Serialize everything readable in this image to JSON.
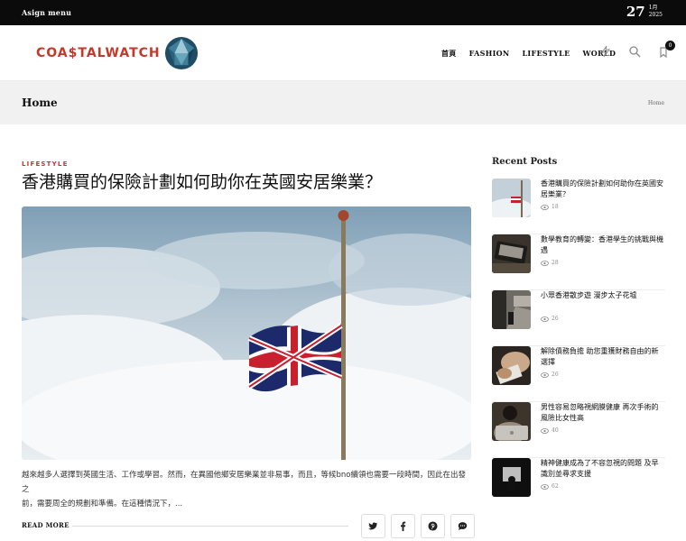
{
  "topbar": {
    "menu_label": "Asign menu",
    "date_day": "27",
    "date_month": "1月",
    "date_year": "2025"
  },
  "header": {
    "logo_text": "COA$TALWATCH",
    "nav": [
      "首頁",
      "FASHION",
      "LIFESTYLE",
      "WORLD"
    ],
    "cart_count": "0"
  },
  "page": {
    "title": "Home",
    "breadcrumb": "Home"
  },
  "article": {
    "category": "LIFESTYLE",
    "title": "香港購買的保險計劃如何助你在英國安居樂業？",
    "excerpt_1": "越來越多人選擇到英國生活、工作或學習。然而，在異國他鄉安居樂業並非易事，而且，等候bno續領也需要一段時間，因此在出發之",
    "excerpt_2": "前，需要周全的規劃和準備。在這種情況下，...",
    "read_more": "READ MORE",
    "share_icons": [
      "twitter-icon",
      "facebook-icon",
      "pinterest-icon",
      "comment-icon"
    ]
  },
  "sidebar": {
    "title": "Recent Posts",
    "posts": [
      {
        "title": "香港購買的保險計劃如何助你在英國安居樂業？",
        "views": "18"
      },
      {
        "title": "數學教育的轉變：香港學生的挑戰與機遇",
        "views": "28"
      },
      {
        "title": "小眾香港散步遊 漫步太子花墟",
        "views": "26"
      },
      {
        "title": "解除債務負擔 助您重獲財務自由的新選擇",
        "views": "26"
      },
      {
        "title": "男性容易忽略視網膜健康 再次手術的風險比女性高",
        "views": "40"
      },
      {
        "title": "精神健康成為了不容忽視的問題 及早識別並尋求支援",
        "views": "62"
      }
    ]
  },
  "colors": {
    "accent": "#c0392b",
    "topbar": "#0b0b0b",
    "band": "#f1f1f1"
  }
}
